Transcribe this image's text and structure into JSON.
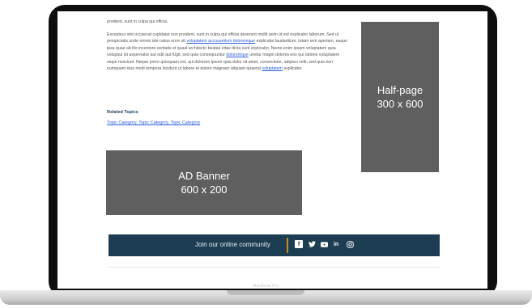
{
  "article": {
    "line_top": "proident, sunt in culpa qui officia.",
    "para_a": "Excepteur sint occaecat cupidatat non proident, sunt in culpa qui officia deserunt mollit anim id est explicabo laborum. Sed ut perspiciatis unde omnis iste natus error sit ",
    "link1": "voluptatem accusantium doloremque",
    "para_b": " explicabo laudantium, totam rem aperiam, eaque ipsa quae ab illo inventore veritatis et quasi architecto beatae vitae dicta sunt explicabo. Nemo enim ipsam voluptatem quia voluptas sit aspernatur aut odit aut fugit, sed quia consequuntur ",
    "link2": "doloremque",
    "para_c": " unetur magni dolores eos qui ratione voluptatem sequi nesciunt. Neque porro quisquam est, qui dolorem ipsum quia dolor sit amet, consectetur, adipisci velit, sed quia non numquam eius modi tempora incidunt ut labore et dolore magnam aliquam quaerat ",
    "link3": "voluptatem",
    "para_d": " explicabo."
  },
  "related": {
    "title": "Related Topics",
    "links": "Topic Category, Topic Category, Topic Category"
  },
  "ads": {
    "half_page_line1": "Half-page",
    "half_page_line2": "300 x 600",
    "banner_line1": "AD Banner",
    "banner_line2": "600 x 200"
  },
  "community": {
    "text": "Join our online community",
    "icons": [
      "facebook-icon",
      "twitter-icon",
      "youtube-icon",
      "linkedin-icon",
      "instagram-icon"
    ],
    "bar_color": "#1c3d52",
    "accent_color": "#c98a1f"
  },
  "device": {
    "label": "MacBook Pro"
  }
}
